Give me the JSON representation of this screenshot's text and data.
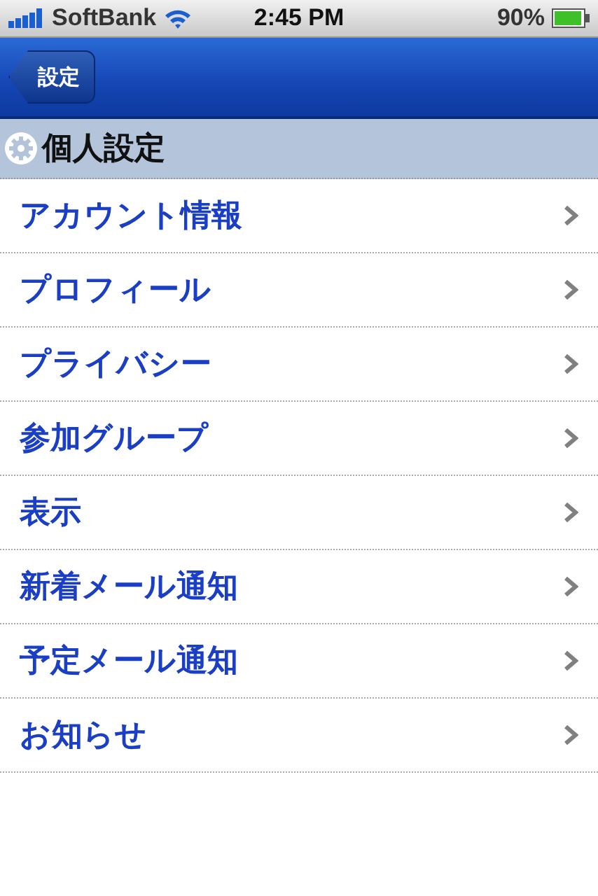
{
  "status_bar": {
    "carrier": "SoftBank",
    "time": "2:45 PM",
    "battery": "90%"
  },
  "nav_bar": {
    "back_button": "設定"
  },
  "section": {
    "title": "個人設定"
  },
  "items": [
    {
      "label": "アカウント情報"
    },
    {
      "label": "プロフィール"
    },
    {
      "label": "プライバシー"
    },
    {
      "label": "参加グループ"
    },
    {
      "label": "表示"
    },
    {
      "label": "新着メール通知"
    },
    {
      "label": "予定メール通知"
    },
    {
      "label": "お知らせ"
    }
  ]
}
